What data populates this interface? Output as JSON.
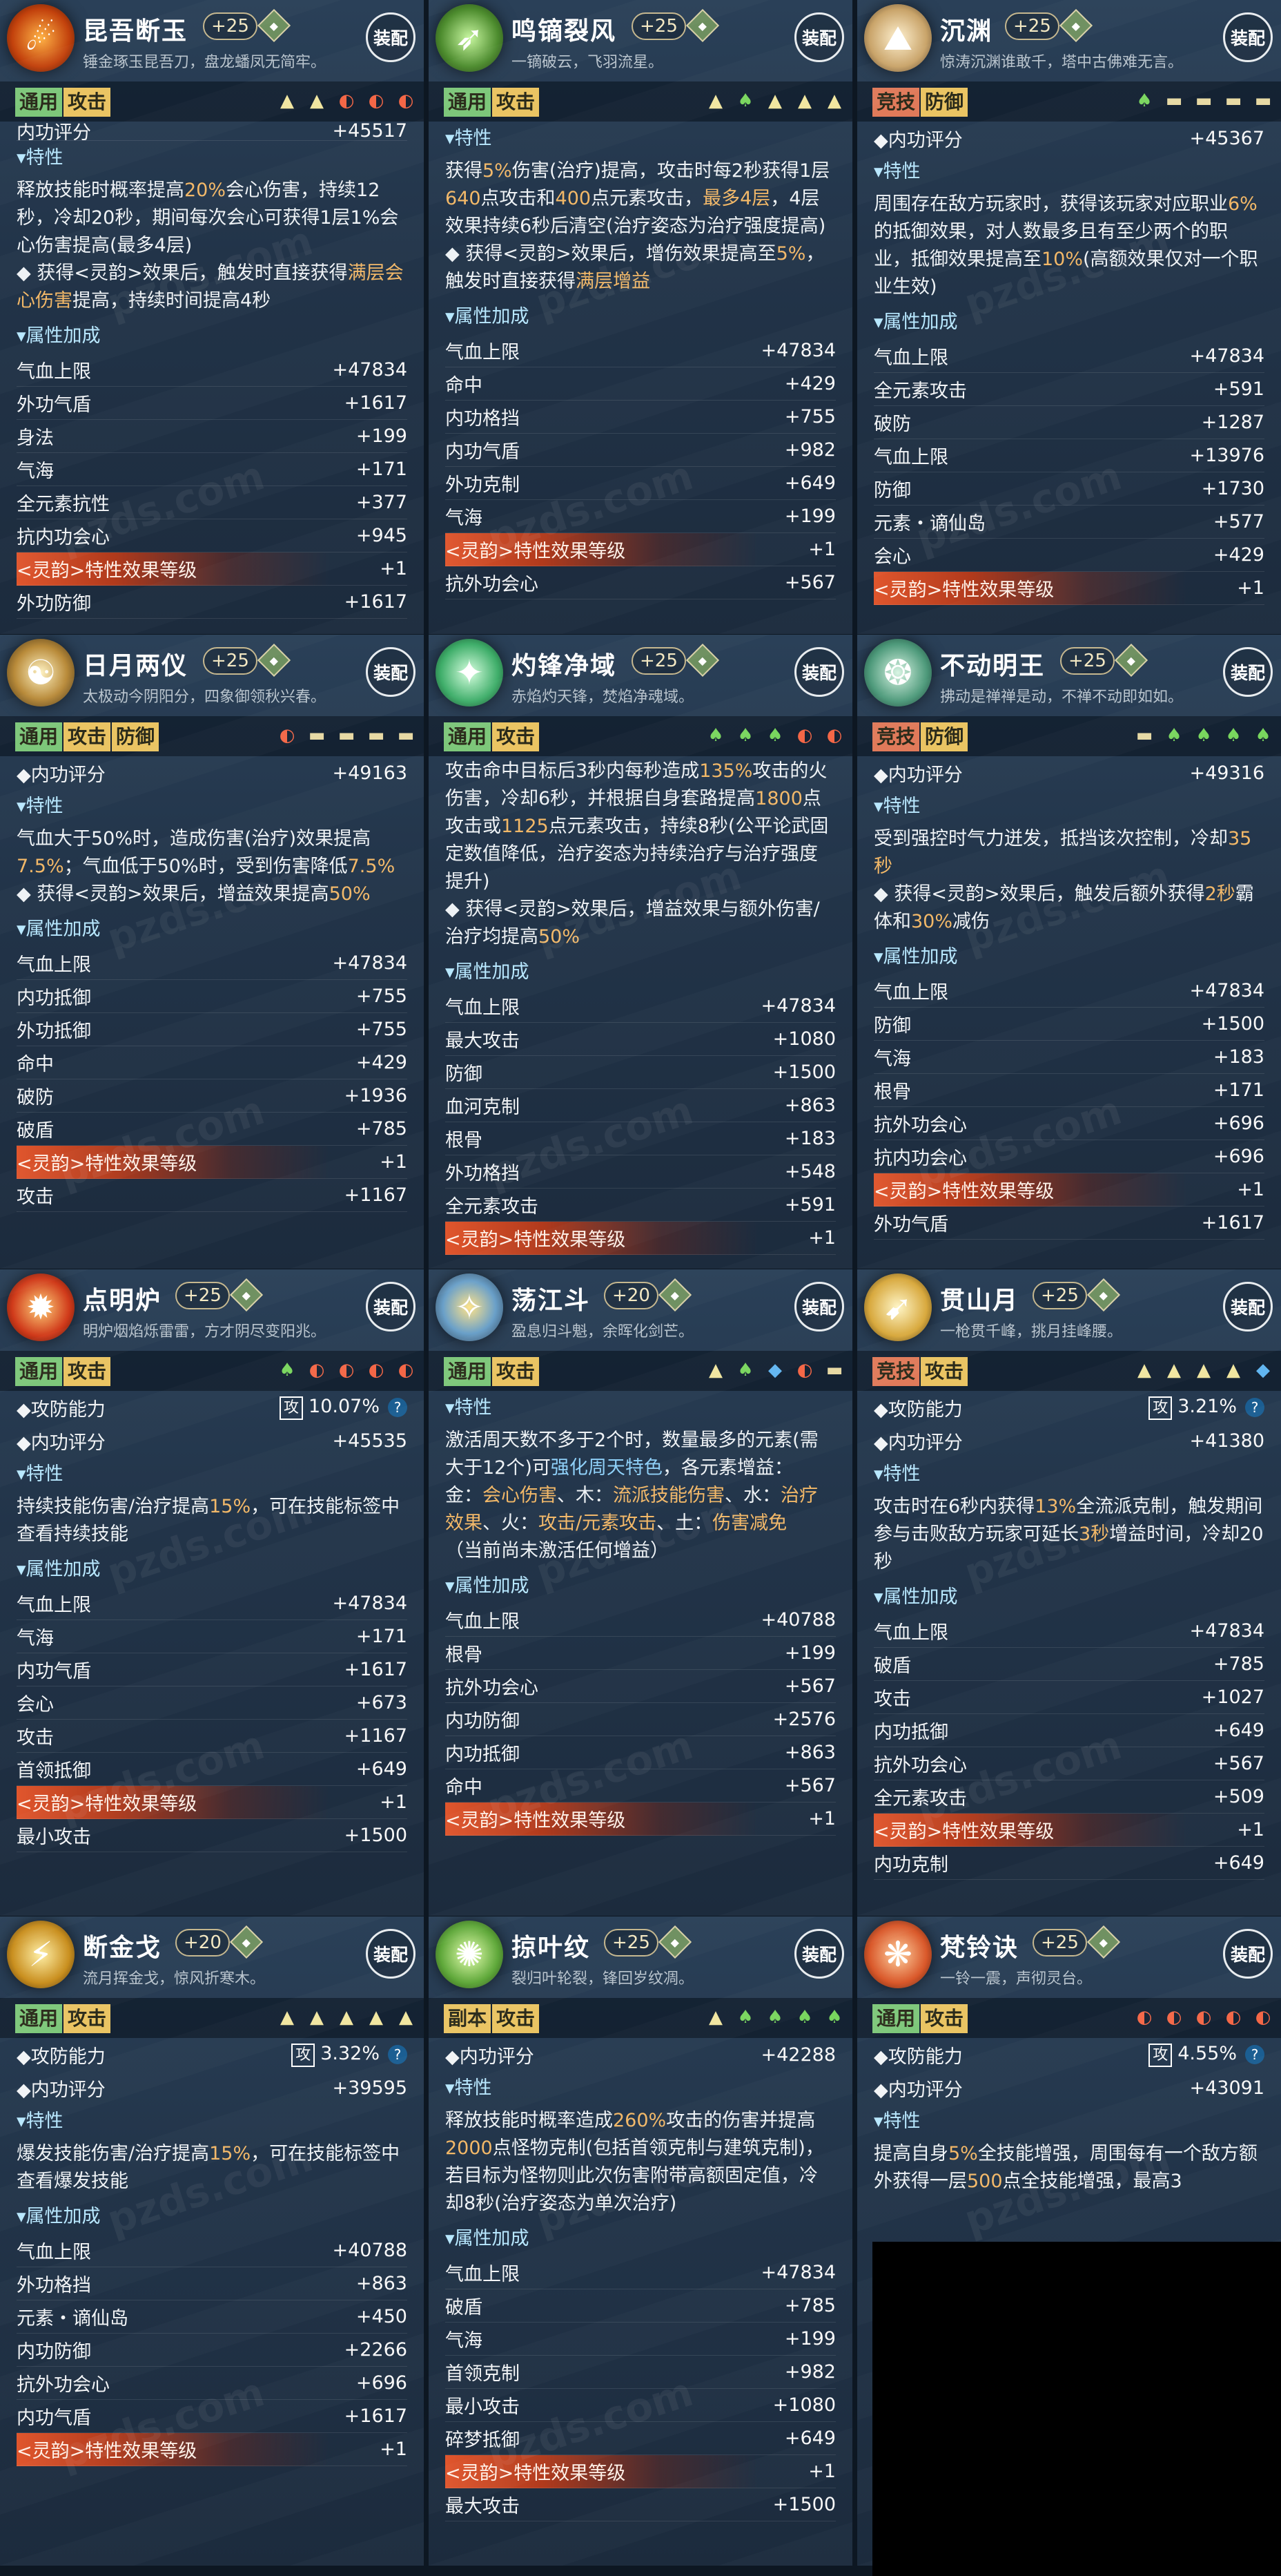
{
  "watermark": "pzds.com",
  "cards": [
    {
      "name": "昆吾断玉",
      "level": "+25",
      "gem": "",
      "motto": "锤金琢玉昆吾刀，盘龙蟠凤无简牢。",
      "equip": "装配",
      "tags": [
        {
          "label": "通用",
          "color": "g"
        },
        {
          "label": "攻击",
          "color": "o"
        }
      ],
      "stars": [
        "t",
        "t",
        "f",
        "f",
        "f"
      ],
      "sections": [
        {
          "type": "cut",
          "label": "内功评分",
          "value": "+45517"
        },
        {
          "type": "header",
          "label": "▾特性"
        },
        {
          "type": "desc",
          "html": "释放技能时概率提高<span class='hl'>20%</span>会心伤害，持续12秒，冷却20秒，期间每次会心可获得1层1%会心伤害提高(最多4层)\n◆ 获得<灵韵>效果后，触发时直接获得<span class='hl'>满层会心伤害</span>提高，持续时间提高4秒"
        },
        {
          "type": "header",
          "label": "▾属性加成"
        },
        {
          "type": "rows",
          "rows": [
            [
              "气血上限",
              "+47834"
            ],
            [
              "外功气盾",
              "+1617"
            ],
            [
              "身法",
              "+199"
            ],
            [
              "气海",
              "+171"
            ],
            [
              "全元素抗性",
              "+377"
            ],
            [
              "抗内功会心",
              "+945"
            ],
            [
              "<灵韵>特性效果等级",
              "+1",
              "spirit"
            ],
            [
              "外功防御",
              "+1617"
            ]
          ]
        }
      ]
    },
    {
      "name": "鸣镝裂风",
      "level": "+25",
      "gem": "",
      "motto": "一镝破云，飞羽流星。",
      "equip": "装配",
      "tags": [
        {
          "label": "通用",
          "color": "g"
        },
        {
          "label": "攻击",
          "color": "o"
        }
      ],
      "stars": [
        "t",
        "l",
        "t",
        "t",
        "t"
      ],
      "sections": [
        {
          "type": "header",
          "label": "▾特性"
        },
        {
          "type": "desc",
          "html": "获得<span class='hl'>5%</span>伤害(治疗)提高，攻击时每2秒获得1层<span class='hl'>640</span>点攻击和<span class='hl'>400</span>点元素攻击，<span class='hl'>最多4层</span>，4层效果持续6秒后清空(治疗姿态为治疗强度提高)\n◆ 获得<灵韵>效果后，增伤效果提高至<span class='hl'>5%</span>，触发时直接获得<span class='hl'>满层增益</span>"
        },
        {
          "type": "header",
          "label": "▾属性加成"
        },
        {
          "type": "rows",
          "rows": [
            [
              "气血上限",
              "+47834"
            ],
            [
              "命中",
              "+429"
            ],
            [
              "内功格挡",
              "+755"
            ],
            [
              "内功气盾",
              "+982"
            ],
            [
              "外功克制",
              "+649"
            ],
            [
              "气海",
              "+199"
            ],
            [
              "<灵韵>特性效果等级",
              "+1",
              "spirit"
            ],
            [
              "抗外功会心",
              "+567"
            ]
          ]
        }
      ]
    },
    {
      "name": "沉渊",
      "level": "+25",
      "gem": "",
      "motto": "惊涛沉渊谁敢千，塔中古佛难无言。",
      "equip": "装配",
      "tags": [
        {
          "label": "竞技",
          "color": "r"
        },
        {
          "label": "防御",
          "color": "o"
        }
      ],
      "stars": [
        "l",
        "e",
        "e",
        "e",
        "e"
      ],
      "sections": [
        {
          "type": "kv",
          "label": "◆内功评分",
          "value": "+45367"
        },
        {
          "type": "header",
          "label": "▾特性"
        },
        {
          "type": "desc",
          "html": "周围存在敌方玩家时，获得该玩家对应职业<span class='hl'>6%</span>的抵御效果，对人数最多且有至少两个的职业，抵御效果提高至<span class='hl'>10%</span>(高额效果仅对一个职业生效)"
        },
        {
          "type": "header",
          "label": "▾属性加成"
        },
        {
          "type": "rows",
          "rows": [
            [
              "气血上限",
              "+47834"
            ],
            [
              "全元素攻击",
              "+591"
            ],
            [
              "破防",
              "+1287"
            ],
            [
              "气血上限",
              "+13976"
            ],
            [
              "防御",
              "+1730"
            ],
            [
              "元素・谪仙岛",
              "+577"
            ],
            [
              "会心",
              "+429"
            ],
            [
              "<灵韵>特性效果等级",
              "+1",
              "spirit"
            ]
          ]
        }
      ]
    },
    {
      "name": "日月两仪",
      "level": "+25",
      "gem": "",
      "motto": "太极动今阴阳分，四象御领秋兴春。",
      "equip": "装配",
      "tags": [
        {
          "label": "通用",
          "color": "g"
        },
        {
          "label": "攻击",
          "color": "o"
        },
        {
          "label": "防御",
          "color": "o"
        }
      ],
      "stars": [
        "f",
        "e",
        "e",
        "e",
        "e"
      ],
      "sections": [
        {
          "type": "kv",
          "label": "◆内功评分",
          "value": "+49163"
        },
        {
          "type": "header",
          "label": "▾特性"
        },
        {
          "type": "desc",
          "html": "气血大于50%时，造成伤害(治疗)效果提高<span class='hl'>7.5%</span>；气血低于50%时，受到伤害降低<span class='hl'>7.5%</span>\n◆ 获得<灵韵>效果后，增益效果提高<span class='hl'>50%</span>"
        },
        {
          "type": "header",
          "label": "▾属性加成"
        },
        {
          "type": "rows",
          "rows": [
            [
              "气血上限",
              "+47834"
            ],
            [
              "内功抵御",
              "+755"
            ],
            [
              "外功抵御",
              "+755"
            ],
            [
              "命中",
              "+429"
            ],
            [
              "破防",
              "+1936"
            ],
            [
              "破盾",
              "+785"
            ],
            [
              "<灵韵>特性效果等级",
              "+1",
              "spirit"
            ],
            [
              "攻击",
              "+1167"
            ]
          ]
        }
      ]
    },
    {
      "name": "灼锋净域",
      "level": "+25",
      "gem": "",
      "motto": "赤焰灼天锋，焚焰净魂域。",
      "equip": "装配",
      "tags": [
        {
          "label": "通用",
          "color": "g"
        },
        {
          "label": "攻击",
          "color": "o"
        }
      ],
      "stars": [
        "l",
        "l",
        "l",
        "f",
        "f"
      ],
      "sections": [
        {
          "type": "desc",
          "html": "攻击命中目标后3秒内每秒造成<span class='hl'>135%</span>攻击的火伤害，冷却6秒，并根据自身套路提高<span class='hl'>1800</span>点攻击或<span class='hl'>1125</span>点元素攻击，持续8秒(公平论武固定数值降低，治疗姿态为持续治疗与治疗强度提升)\n◆ 获得<灵韵>效果后，增益效果与额外伤害/治疗均提高<span class='hl'>50%</span>"
        },
        {
          "type": "header",
          "label": "▾属性加成"
        },
        {
          "type": "rows",
          "rows": [
            [
              "气血上限",
              "+47834"
            ],
            [
              "最大攻击",
              "+1080"
            ],
            [
              "防御",
              "+1500"
            ],
            [
              "血河克制",
              "+863"
            ],
            [
              "根骨",
              "+183"
            ],
            [
              "外功格挡",
              "+548"
            ],
            [
              "全元素攻击",
              "+591"
            ],
            [
              "<灵韵>特性效果等级",
              "+1",
              "spirit"
            ]
          ]
        }
      ]
    },
    {
      "name": "不动明王",
      "level": "+25",
      "gem": "",
      "motto": "拂动是禅禅是动，不禅不动即如如。",
      "equip": "装配",
      "tags": [
        {
          "label": "竞技",
          "color": "r"
        },
        {
          "label": "防御",
          "color": "o"
        }
      ],
      "stars": [
        "e",
        "l",
        "l",
        "l",
        "l"
      ],
      "sections": [
        {
          "type": "kv",
          "label": "◆内功评分",
          "value": "+49316"
        },
        {
          "type": "header",
          "label": "▾特性"
        },
        {
          "type": "desc",
          "html": "受到强控时气力迸发，抵挡该次控制，冷却<span class='hl'>35秒</span>\n◆ 获得<灵韵>效果后，触发后额外获得<span class='hl'>2秒</span>霸体和<span class='hl'>30%</span>减伤"
        },
        {
          "type": "header",
          "label": "▾属性加成"
        },
        {
          "type": "rows",
          "rows": [
            [
              "气血上限",
              "+47834"
            ],
            [
              "防御",
              "+1500"
            ],
            [
              "气海",
              "+183"
            ],
            [
              "根骨",
              "+171"
            ],
            [
              "抗外功会心",
              "+696"
            ],
            [
              "抗内功会心",
              "+696"
            ],
            [
              "<灵韵>特性效果等级",
              "+1",
              "spirit"
            ],
            [
              "外功气盾",
              "+1617"
            ]
          ]
        }
      ]
    },
    {
      "name": "点明炉",
      "level": "+25",
      "gem": "",
      "motto": "明炉烟焰烁雷雷，方才阴尽变阳兆。",
      "equip": "装配",
      "tags": [
        {
          "label": "通用",
          "color": "g"
        },
        {
          "label": "攻击",
          "color": "o"
        }
      ],
      "stars": [
        "l",
        "f",
        "f",
        "f",
        "f"
      ],
      "sections": [
        {
          "type": "pow",
          "label": "◆攻防能力",
          "box": "攻",
          "value": "10.07%",
          "q": "?"
        },
        {
          "type": "kv",
          "label": "◆内功评分",
          "value": "+45535"
        },
        {
          "type": "header",
          "label": "▾特性"
        },
        {
          "type": "desc",
          "html": "持续技能伤害/治疗提高<span class='hl'>15%</span>，可在技能标签中查看持续技能"
        },
        {
          "type": "header",
          "label": "▾属性加成"
        },
        {
          "type": "rows",
          "rows": [
            [
              "气血上限",
              "+47834"
            ],
            [
              "气海",
              "+171"
            ],
            [
              "内功气盾",
              "+1617"
            ],
            [
              "会心",
              "+673"
            ],
            [
              "攻击",
              "+1167"
            ],
            [
              "首领抵御",
              "+649"
            ],
            [
              "<灵韵>特性效果等级",
              "+1",
              "spirit"
            ],
            [
              "最小攻击",
              "+1500"
            ]
          ]
        }
      ]
    },
    {
      "name": "荡江斗",
      "level": "+20",
      "gem": "",
      "motto": "盈息归斗魁，余晖化剑芒。",
      "equip": "装配",
      "tags": [
        {
          "label": "通用",
          "color": "g"
        },
        {
          "label": "攻击",
          "color": "o"
        }
      ],
      "stars": [
        "t",
        "l",
        "w",
        "f",
        "e"
      ],
      "sections": [
        {
          "type": "header",
          "label": "▾特性"
        },
        {
          "type": "desc",
          "html": "激活周天数不多于2个时，数量最多的元素(需大于12个)可<span class='hl2'>强化周天特色</span>，各元素增益：\n金：<span class='hl'>会心伤害</span>、木：<span class='hl'>流派技能伤害</span>、水：<span class='hl'>治疗效果</span>、火：<span class='hl'>攻击/元素攻击</span>、土：<span class='hl'>伤害减免</span>\n（当前尚未激活任何增益）"
        },
        {
          "type": "header",
          "label": "▾属性加成"
        },
        {
          "type": "rows",
          "rows": [
            [
              "气血上限",
              "+40788"
            ],
            [
              "根骨",
              "+199"
            ],
            [
              "抗外功会心",
              "+567"
            ],
            [
              "内功防御",
              "+2576"
            ],
            [
              "内功抵御",
              "+863"
            ],
            [
              "命中",
              "+567"
            ],
            [
              "<灵韵>特性效果等级",
              "+1",
              "spirit"
            ]
          ]
        }
      ]
    },
    {
      "name": "贯山月",
      "level": "+25",
      "gem": "",
      "motto": "一枪贯千峰，挑月挂峰腰。",
      "equip": "装配",
      "tags": [
        {
          "label": "竞技",
          "color": "r"
        },
        {
          "label": "攻击",
          "color": "o"
        }
      ],
      "stars": [
        "t",
        "t",
        "t",
        "t",
        "w"
      ],
      "sections": [
        {
          "type": "pow",
          "label": "◆攻防能力",
          "box": "攻",
          "value": "3.21%",
          "q": "?"
        },
        {
          "type": "kv",
          "label": "◆内功评分",
          "value": "+41380"
        },
        {
          "type": "header",
          "label": "▾特性"
        },
        {
          "type": "desc",
          "html": "攻击时在6秒内获得<span class='hl'>13%</span>全流派克制，触发期间参与击败敌方玩家可延长<span class='hl'>3秒</span>增益时间，冷却20秒"
        },
        {
          "type": "header",
          "label": "▾属性加成"
        },
        {
          "type": "rows",
          "rows": [
            [
              "气血上限",
              "+47834"
            ],
            [
              "破盾",
              "+785"
            ],
            [
              "攻击",
              "+1027"
            ],
            [
              "内功抵御",
              "+649"
            ],
            [
              "抗外功会心",
              "+567"
            ],
            [
              "全元素攻击",
              "+509"
            ],
            [
              "<灵韵>特性效果等级",
              "+1",
              "spirit"
            ],
            [
              "内功克制",
              "+649"
            ]
          ]
        }
      ]
    },
    {
      "name": "断金戈",
      "level": "+20",
      "gem": "",
      "motto": "流月挥金戈，惊风折寒木。",
      "equip": "装配",
      "tags": [
        {
          "label": "通用",
          "color": "g"
        },
        {
          "label": "攻击",
          "color": "o"
        }
      ],
      "stars": [
        "t",
        "t",
        "t",
        "t",
        "t"
      ],
      "sections": [
        {
          "type": "pow",
          "label": "◆攻防能力",
          "box": "攻",
          "value": "3.32%",
          "q": "?"
        },
        {
          "type": "kv",
          "label": "◆内功评分",
          "value": "+39595"
        },
        {
          "type": "header",
          "label": "▾特性"
        },
        {
          "type": "desc",
          "html": "爆发技能伤害/治疗提高<span class='hl'>15%</span>，可在技能标签中查看爆发技能"
        },
        {
          "type": "header",
          "label": "▾属性加成"
        },
        {
          "type": "rows",
          "rows": [
            [
              "气血上限",
              "+40788"
            ],
            [
              "外功格挡",
              "+863"
            ],
            [
              "元素・谪仙岛",
              "+450"
            ],
            [
              "内功防御",
              "+2266"
            ],
            [
              "抗外功会心",
              "+696"
            ],
            [
              "内功气盾",
              "+1617"
            ],
            [
              "<灵韵>特性效果等级",
              "+1",
              "spirit"
            ]
          ]
        }
      ]
    },
    {
      "name": "掠叶纹",
      "level": "+25",
      "gem": "",
      "motto": "裂归叶轮裂，锋回岁纹凋。",
      "equip": "装配",
      "tags": [
        {
          "label": "副本",
          "color": "o"
        },
        {
          "label": "攻击",
          "color": "o"
        }
      ],
      "stars": [
        "t",
        "l",
        "l",
        "l",
        "l"
      ],
      "sections": [
        {
          "type": "kv",
          "label": "◆内功评分",
          "value": "+42288"
        },
        {
          "type": "header",
          "label": "▾特性"
        },
        {
          "type": "desc",
          "html": "释放技能时概率造成<span class='hl'>260%</span>攻击的伤害并提高<span class='hl'>2000</span>点怪物克制(包括首领克制与建筑克制)，若目标为怪物则此次伤害附带高额固定值，冷却8秒(治疗姿态为单次治疗)"
        },
        {
          "type": "header",
          "label": "▾属性加成"
        },
        {
          "type": "rows",
          "rows": [
            [
              "气血上限",
              "+47834"
            ],
            [
              "破盾",
              "+785"
            ],
            [
              "气海",
              "+199"
            ],
            [
              "首领克制",
              "+982"
            ],
            [
              "最小攻击",
              "+1080"
            ],
            [
              "碎梦抵御",
              "+649"
            ],
            [
              "<灵韵>特性效果等级",
              "+1",
              "spirit"
            ],
            [
              "最大攻击",
              "+1500"
            ]
          ]
        }
      ]
    },
    {
      "name": "梵铃诀",
      "level": "+25",
      "gem": "",
      "motto": "一铃一震，声彻灵台。",
      "equip": "装配",
      "tags": [
        {
          "label": "通用",
          "color": "g"
        },
        {
          "label": "攻击",
          "color": "o"
        }
      ],
      "stars": [
        "f",
        "f",
        "f",
        "f",
        "f"
      ],
      "sections": [
        {
          "type": "pow",
          "label": "◆攻防能力",
          "box": "攻",
          "value": "4.55%",
          "q": "?"
        },
        {
          "type": "kv",
          "label": "◆内功评分",
          "value": "+43091"
        },
        {
          "type": "header",
          "label": "▾特性"
        },
        {
          "type": "desc",
          "html": "提高自身<span class='hl'>5%</span>全技能增强，周围每有一个敌方额外获得一层<span class='hl'>500</span>点全技能增强，最高3"
        }
      ]
    }
  ]
}
